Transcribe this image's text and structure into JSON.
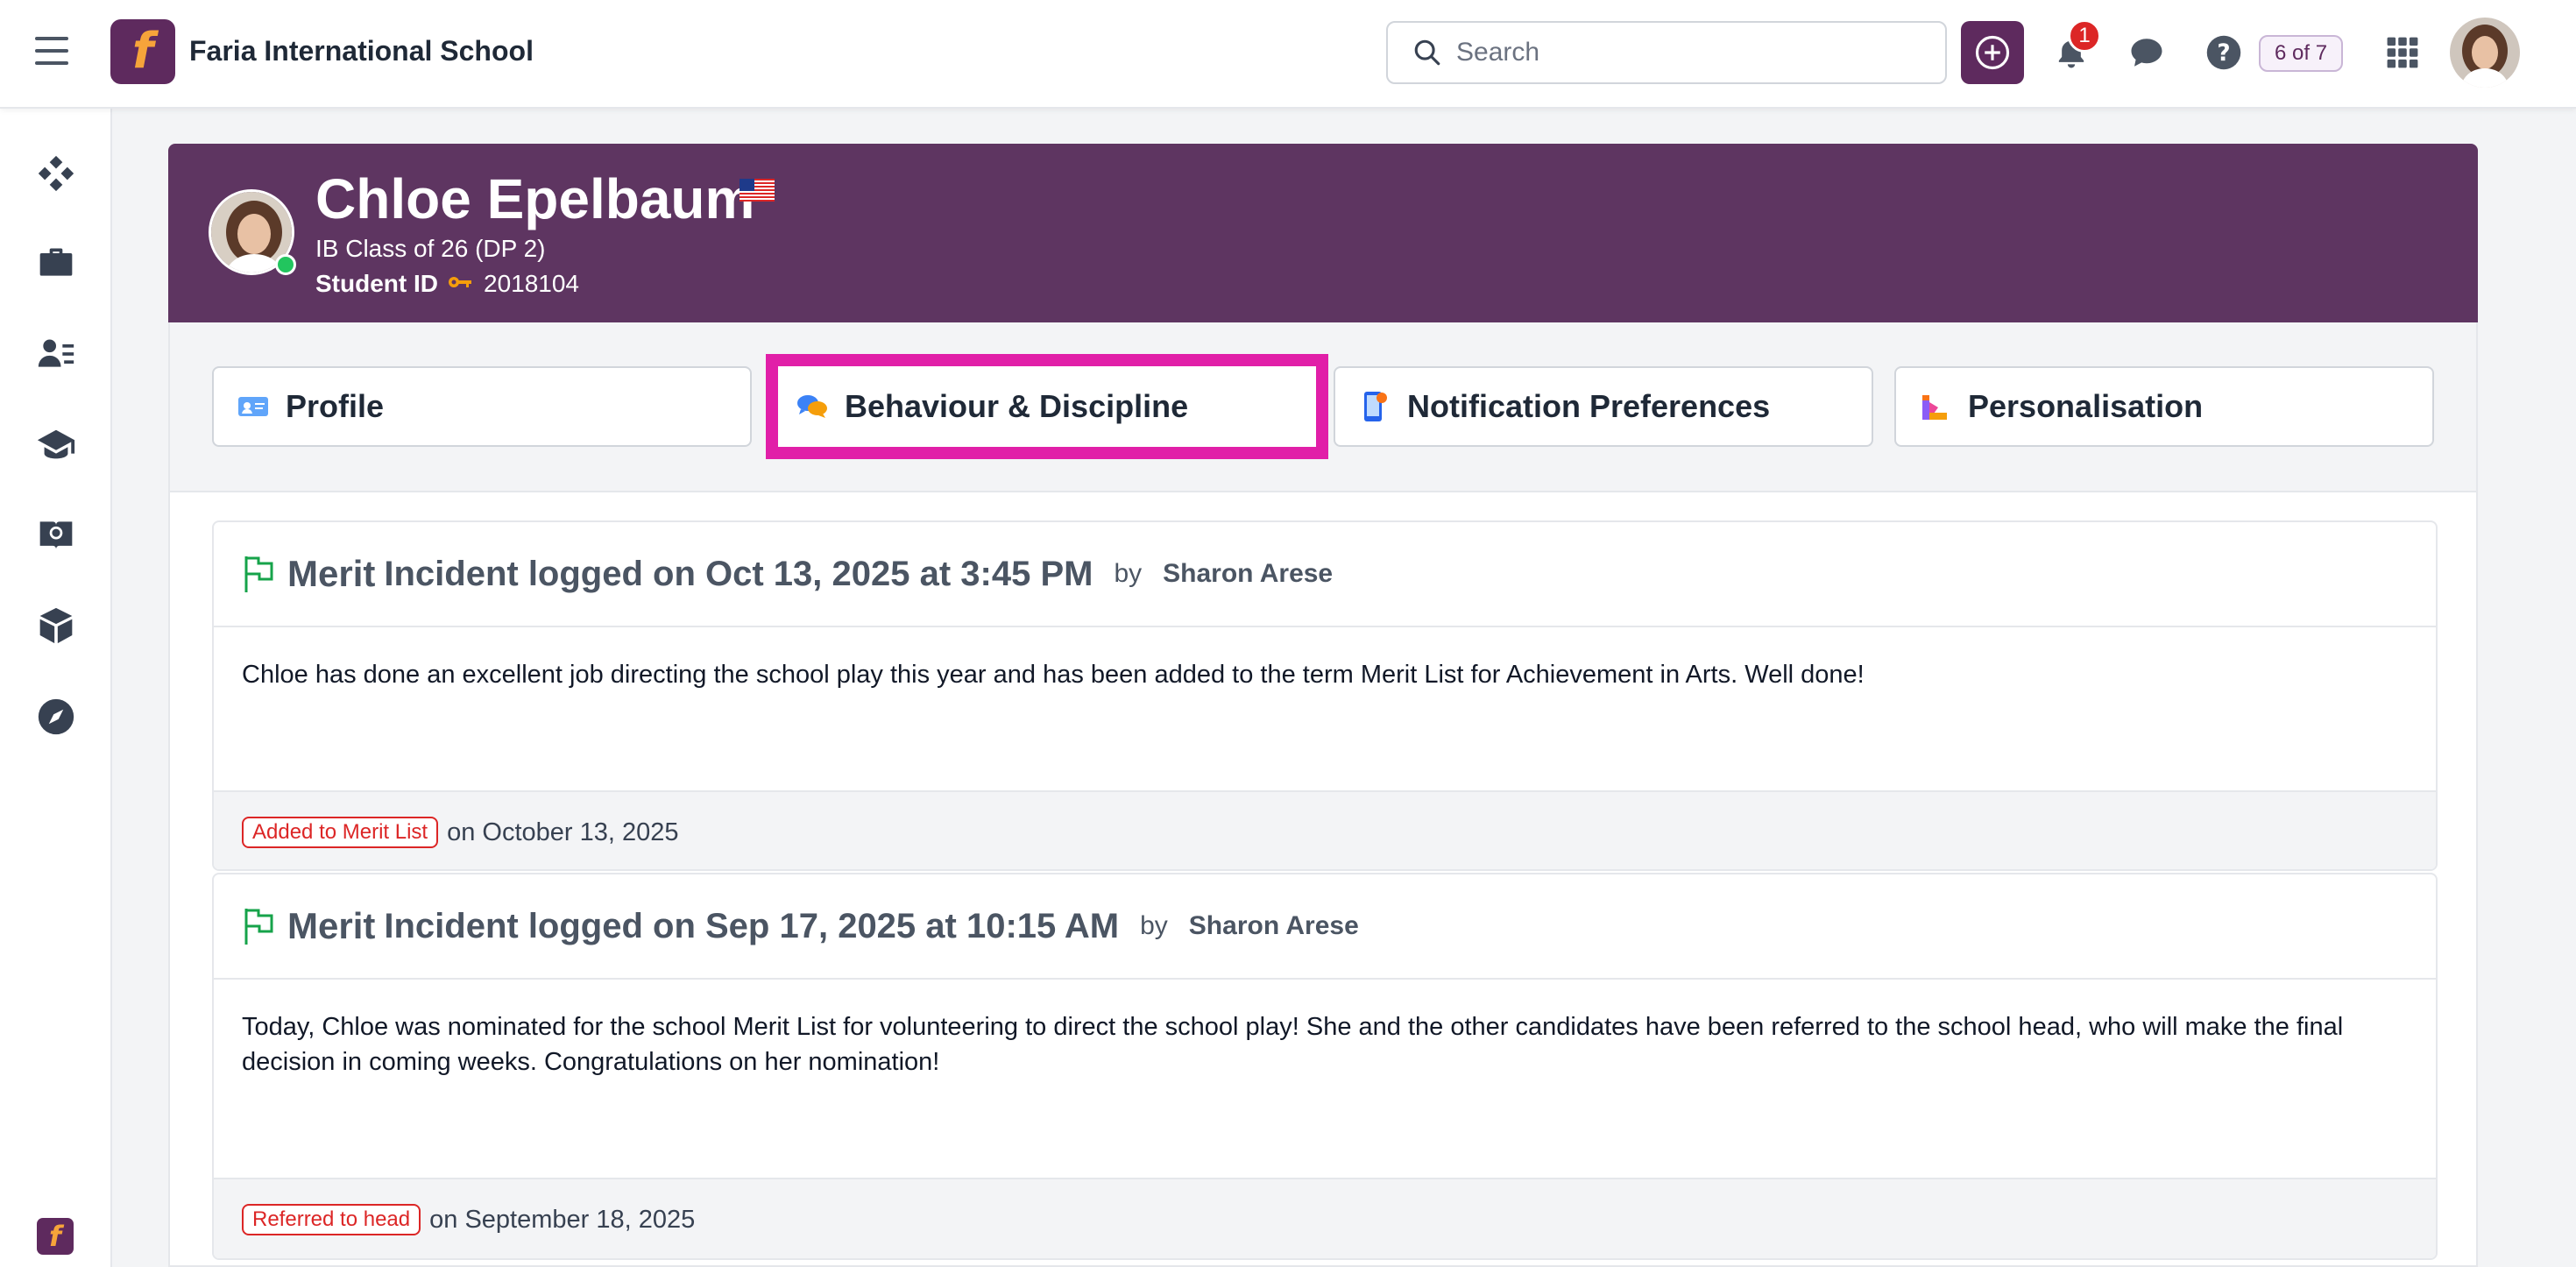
{
  "header": {
    "school_name": "Faria International School",
    "logo_letter": "f",
    "search_placeholder": "Search",
    "notification_count": "1",
    "pager": "6 of 7"
  },
  "sidebar": {
    "items": [
      {
        "icon": "diamond-grid-icon"
      },
      {
        "icon": "briefcase-icon"
      },
      {
        "icon": "people-list-icon"
      },
      {
        "icon": "graduation-cap-icon"
      },
      {
        "icon": "globe-book-icon"
      },
      {
        "icon": "cube-icon"
      },
      {
        "icon": "compass-icon"
      }
    ]
  },
  "student": {
    "name": "Chloe Epelbaum",
    "class": "IB Class of 26 (DP 2)",
    "id_label": "Student ID",
    "id_value": "2018104",
    "flag": "us-flag-icon"
  },
  "tabs": [
    {
      "label": "Profile",
      "icon": "id-card-icon"
    },
    {
      "label": "Behaviour & Discipline",
      "icon": "speech-bubbles-icon",
      "active": true
    },
    {
      "label": "Notification Preferences",
      "icon": "phone-notification-icon"
    },
    {
      "label": "Personalisation",
      "icon": "palette-icon"
    }
  ],
  "incidents": [
    {
      "type": "Merit",
      "logged": "Incident logged on Oct 13, 2025 at 3:45 PM",
      "by": "by",
      "author": "Sharon Arese",
      "body": "Chloe has done an excellent job directing the school play this year and has been added to the term Merit List for Achievement in Arts. Well done!",
      "tag": "Added to Merit List",
      "tag_date": "on October 13, 2025"
    },
    {
      "type": "Merit",
      "logged": "Incident logged on Sep 17, 2025 at 10:15 AM",
      "by": "by",
      "author": "Sharon Arese",
      "body": "Today, Chloe was nominated for the school Merit List for volunteering to direct the school play! She and the other candidates have been referred to the school head, who will make the final decision in coming weeks. Congratulations on her nomination!",
      "tag": "Referred to head",
      "tag_date": "on September 18, 2025"
    }
  ],
  "colors": {
    "brand": "#5e2a5e",
    "header_bg": "#5e3561",
    "highlight": "#e11fa8",
    "tag_red": "#dc2626",
    "merit_green": "#16a34a"
  }
}
